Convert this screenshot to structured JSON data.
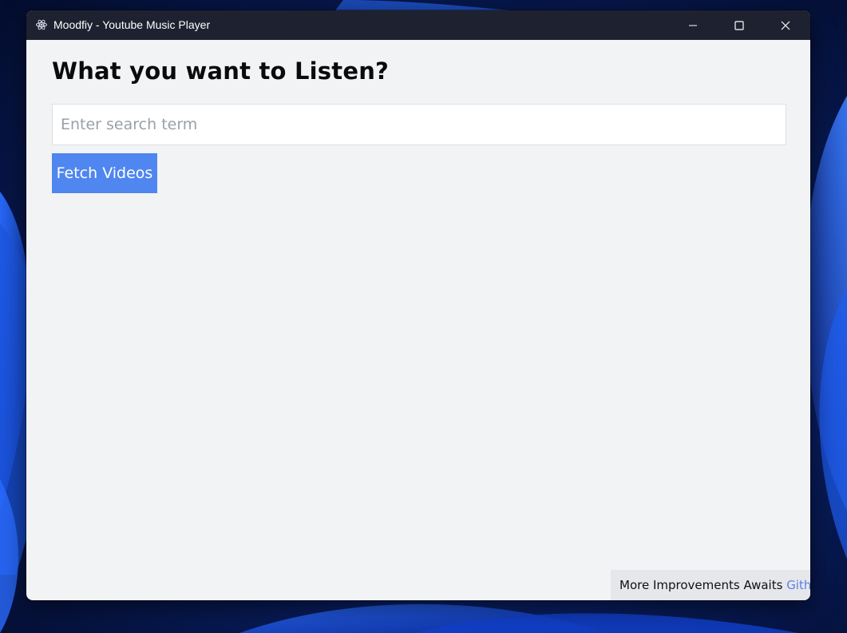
{
  "window": {
    "title": "Moodfiy - Youtube Music Player",
    "app_icon": "electron-atom-icon",
    "controls": {
      "minimize_icon": "minimize-icon",
      "maximize_icon": "maximize-icon",
      "close_icon": "close-icon"
    }
  },
  "main": {
    "heading": "What you want to Listen?",
    "search": {
      "placeholder": "Enter search term",
      "value": ""
    },
    "fetch_button_label": "Fetch Videos"
  },
  "footer": {
    "text": "More Improvements Awaits",
    "link_label": "Github"
  },
  "colors": {
    "titlebar": "#1e2230",
    "content_bg": "#f2f3f5",
    "button_bg": "#4f86f0",
    "link": "#5b7fe6",
    "footer_bg": "#e5e7eb"
  }
}
